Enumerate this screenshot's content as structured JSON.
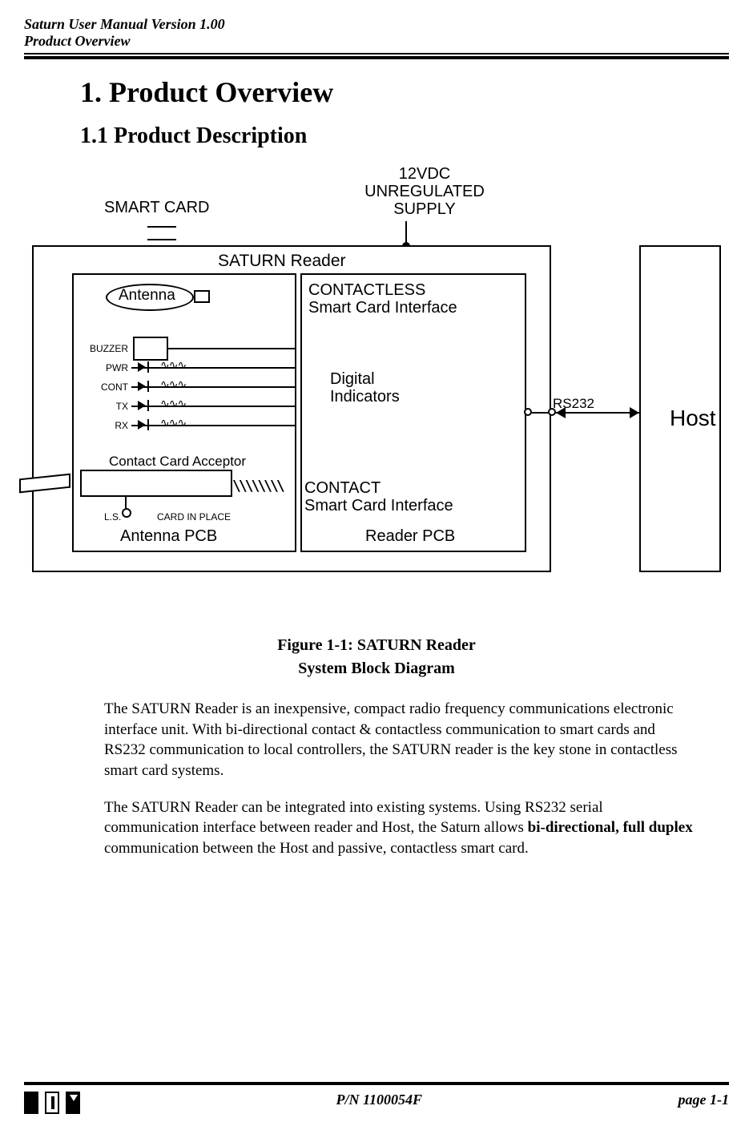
{
  "header": {
    "title": "Saturn User Manual Version 1.00",
    "subtitle": "Product Overview"
  },
  "headings": {
    "h1": "1.  Product Overview",
    "h2": "1.1  Product Description"
  },
  "diagram": {
    "smartcard": "SMART CARD",
    "supply": "12VDC\nUNREGULATED\nSUPPLY",
    "saturn": "SATURN Reader",
    "antenna": "Antenna",
    "contactless_l1": "CONTACTLESS",
    "contactless_l2": "Smart Card Interface",
    "digital_l1": "Digital",
    "digital_l2": "Indicators",
    "contact_l1": "CONTACT",
    "contact_l2": "Smart Card Interface",
    "antenna_pcb": "Antenna PCB",
    "reader_pcb": "Reader PCB",
    "contact_acceptor": "Contact Card Acceptor",
    "card_in_place": "CARD IN PLACE",
    "ls": "L.S.",
    "rs232": "RS232",
    "host": "Host",
    "signals": {
      "buzzer": "BUZZER",
      "pwr": "PWR",
      "cont": "CONT",
      "tx": "TX",
      "rx": "RX"
    }
  },
  "figure": {
    "line1": "Figure 1-1: SATURN Reader",
    "line2": "System Block Diagram"
  },
  "paragraphs": {
    "p1": "The SATURN Reader is an inexpensive, compact radio frequency communications electronic interface unit. With bi-directional contact & contactless communication to smart cards and RS232 communication to local controllers, the SATURN reader is the key stone in contactless smart card systems.",
    "p2_a": "The SATURN Reader can be integrated into existing systems. Using RS232 serial communication interface between reader and Host, the Saturn allows ",
    "p2_bold": "bi-directional, full duplex",
    "p2_b": " communication between the Host and passive, contactless smart card."
  },
  "footer": {
    "pn": "P/N 1100054F",
    "page": "page 1-1"
  }
}
